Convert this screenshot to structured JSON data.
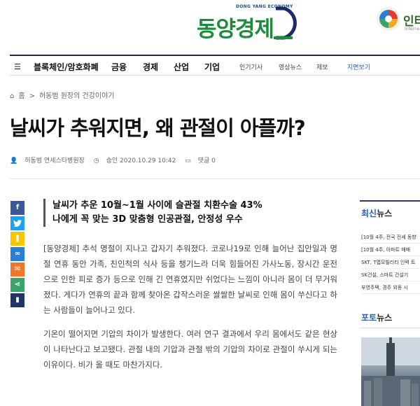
{
  "masthead": {
    "logo_sub": "DONG YANG ECONOMY",
    "logo_text": "동양경제",
    "partner_text": "인터",
    "partner_sub": "Interne"
  },
  "nav": {
    "items": [
      "블록체인/암호화폐",
      "금융",
      "경제",
      "산업",
      "기업"
    ],
    "subitems": [
      "인기기사",
      "영상뉴스",
      "제보",
      "지면보기"
    ]
  },
  "breadcrumb": {
    "home": "홈",
    "sep": ">",
    "section": "허동범 원장의 건강이야기"
  },
  "article": {
    "title": "날씨가 추워지면, 왜 관절이 아플까?",
    "author": "허동범 연세스타병원장",
    "approved": "승인 2020.10.29 10:42",
    "comments": "댓글 0",
    "subhead": [
      "날씨가 추운 10월~1월 사이에 슬관절 치환수술 43%",
      "나에게 꼭 맞는 3D 맞춤형 인공관절, 안정성 우수"
    ],
    "paragraphs": [
      "[동양경제] 추석 명절이 지나고 갑자기 추워졌다. 코로나19로 인해 늘어난 집안일과 명절 연휴 동안 가족, 친인척의 식사 등을 챙기느라 더욱 힘들어진 가사노동, 장시간 운전으로 인한 피로 증가 등으로 인해 긴 연휴였지만 쉬었다는 느낌이 아니라 몸이 더 무거워졌다. 게다가 연휴의 끝과 함께 찾아온 갑작스러운 쌀쌀한 날씨로 인해 몸이 쑤신다고 하는 사람들이 늘어나고 있다.",
      "기온이 떨어지면 기압의 차이가 발생한다. 여러 연구 결과에서 우리 몸에서도 같은 현상이 나타난다고 보고됐다. 관절 내의 기압과 관절 밖의 기압의 차이로 관절이 쑤시게 되는 이유이다. 비가 올 때도 마찬가지다."
    ]
  },
  "share_buttons": [
    "f",
    "t",
    "k",
    "link",
    "mail",
    "share",
    "save"
  ],
  "sidebar": {
    "latest_hl": "최신",
    "latest_rest": "뉴스",
    "latest": [
      "[10월 4주, 전국 전세 동향",
      "[10월 4주, 아파트 매매",
      "SKT, T맵모빌리티 인력 트",
      "SK건설, 스마트 건설기",
      "부영주택, 경주 외동 시"
    ],
    "photo_hl": "포토",
    "photo_rest": "뉴스"
  },
  "colors": {
    "brand_green": "#1f8a3b",
    "brand_navy": "#1f2a44",
    "accent_blue": "#2a5fb0",
    "facebook": "#3b5998",
    "twitter": "#1da1f2",
    "kakao": "#f7c600",
    "link": "#2a7fd4",
    "mail": "#f0772a",
    "share": "#3aa36b",
    "bookmark": "#223366"
  }
}
